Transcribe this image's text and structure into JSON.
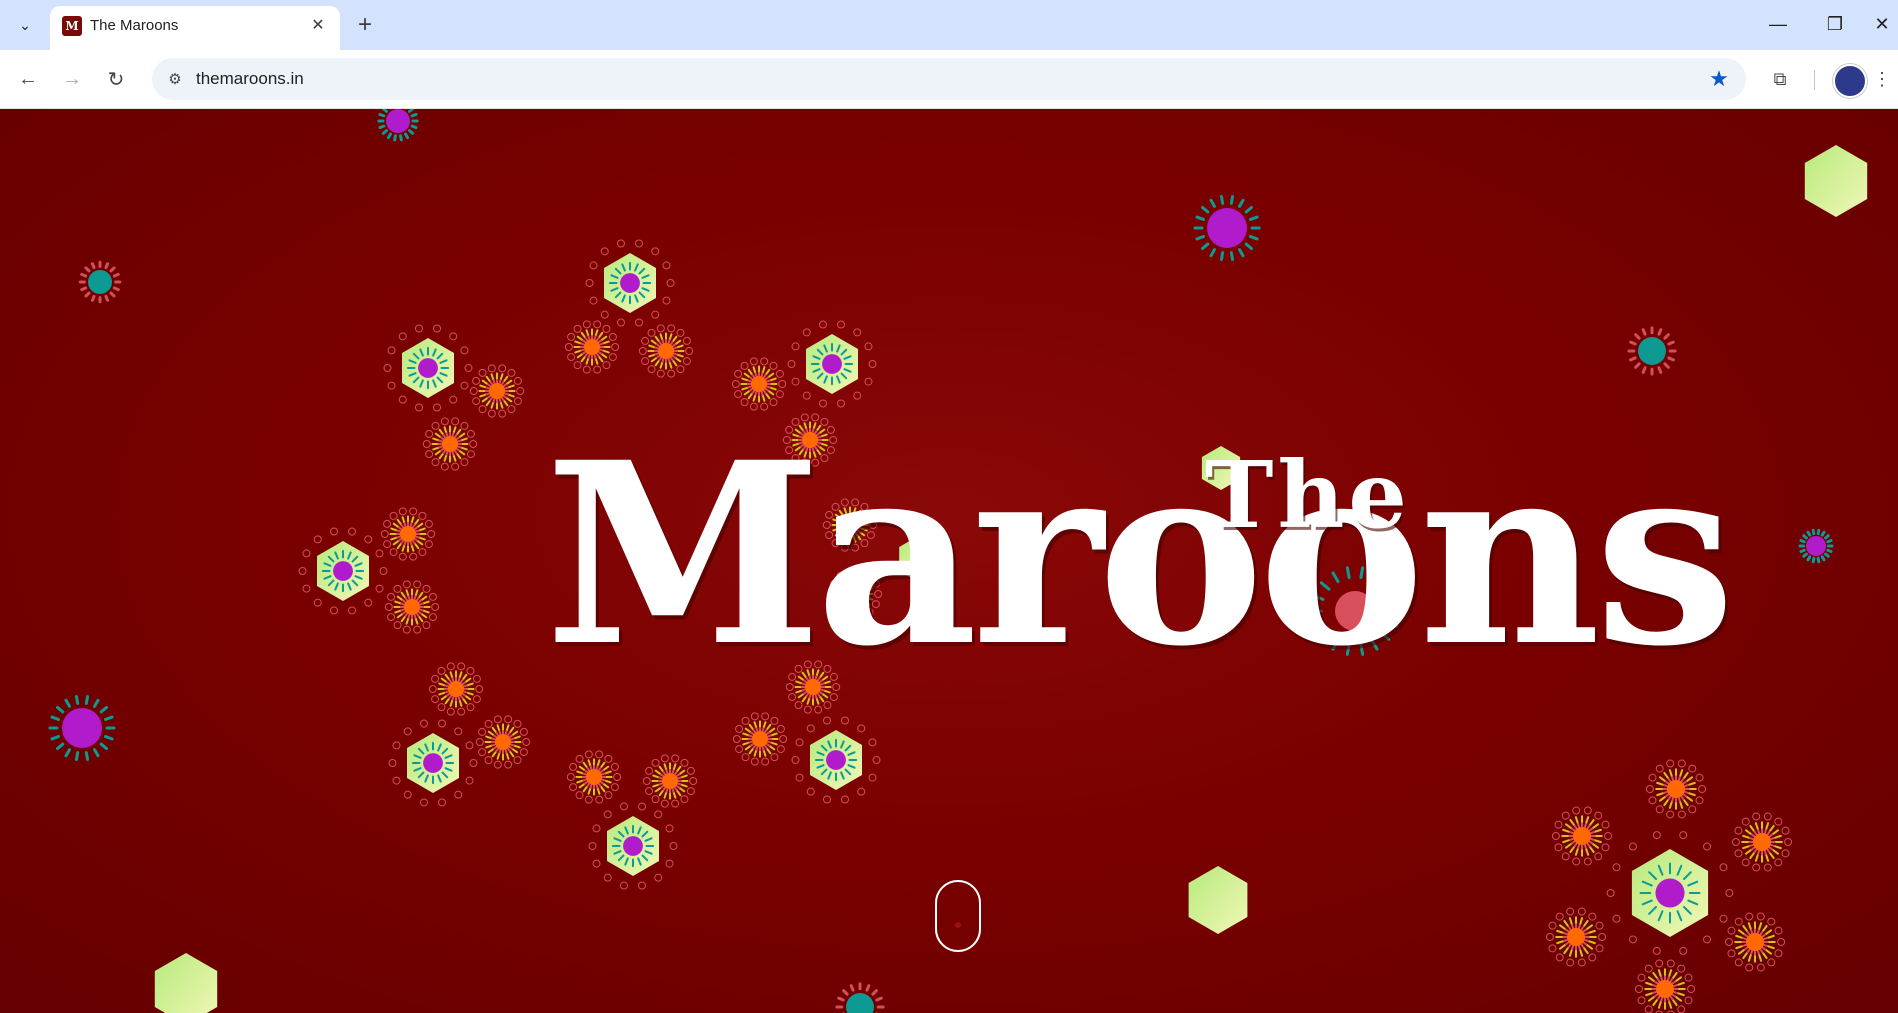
{
  "browser": {
    "tab": {
      "title": "The Maroons",
      "favicon_letter": "M"
    },
    "address": {
      "url": "themaroons.in"
    }
  },
  "page": {
    "title_small": "The",
    "title_large": "Maroons"
  },
  "colors": {
    "maroon": "#7a0000",
    "magenta": "#b01ccc",
    "teal": "#0c9a92",
    "orange": "#ff6a00",
    "yellow": "#d4c21a",
    "pale_green": "#cdf3a4",
    "pink_dot": "#d44f5c"
  },
  "icons": {
    "tab_search": "chevron-down-icon",
    "tab_close": "close-icon",
    "new_tab": "plus-icon",
    "back": "arrow-left-icon",
    "forward": "arrow-right-icon",
    "reload": "reload-icon",
    "site_info": "tune-icon",
    "bookmark": "star-icon",
    "extensions": "puzzle-icon",
    "menu": "kebab-icon"
  }
}
